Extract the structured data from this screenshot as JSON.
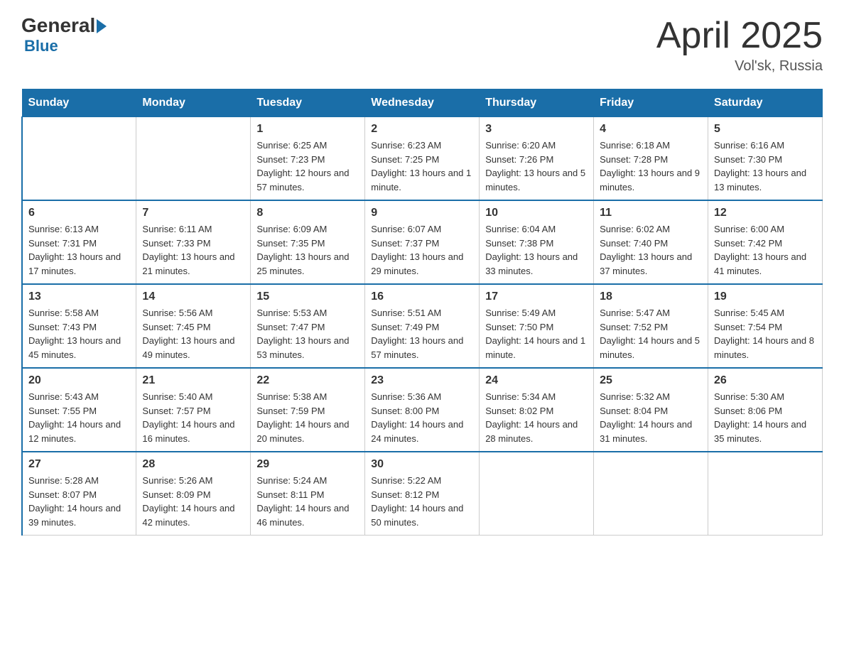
{
  "header": {
    "logo": {
      "general": "General",
      "blue": "Blue"
    },
    "title": "April 2025",
    "location": "Vol'sk, Russia"
  },
  "days_of_week": [
    "Sunday",
    "Monday",
    "Tuesday",
    "Wednesday",
    "Thursday",
    "Friday",
    "Saturday"
  ],
  "weeks": [
    [
      {
        "day": "",
        "sunrise": "",
        "sunset": "",
        "daylight": ""
      },
      {
        "day": "",
        "sunrise": "",
        "sunset": "",
        "daylight": ""
      },
      {
        "day": "1",
        "sunrise": "Sunrise: 6:25 AM",
        "sunset": "Sunset: 7:23 PM",
        "daylight": "Daylight: 12 hours and 57 minutes."
      },
      {
        "day": "2",
        "sunrise": "Sunrise: 6:23 AM",
        "sunset": "Sunset: 7:25 PM",
        "daylight": "Daylight: 13 hours and 1 minute."
      },
      {
        "day": "3",
        "sunrise": "Sunrise: 6:20 AM",
        "sunset": "Sunset: 7:26 PM",
        "daylight": "Daylight: 13 hours and 5 minutes."
      },
      {
        "day": "4",
        "sunrise": "Sunrise: 6:18 AM",
        "sunset": "Sunset: 7:28 PM",
        "daylight": "Daylight: 13 hours and 9 minutes."
      },
      {
        "day": "5",
        "sunrise": "Sunrise: 6:16 AM",
        "sunset": "Sunset: 7:30 PM",
        "daylight": "Daylight: 13 hours and 13 minutes."
      }
    ],
    [
      {
        "day": "6",
        "sunrise": "Sunrise: 6:13 AM",
        "sunset": "Sunset: 7:31 PM",
        "daylight": "Daylight: 13 hours and 17 minutes."
      },
      {
        "day": "7",
        "sunrise": "Sunrise: 6:11 AM",
        "sunset": "Sunset: 7:33 PM",
        "daylight": "Daylight: 13 hours and 21 minutes."
      },
      {
        "day": "8",
        "sunrise": "Sunrise: 6:09 AM",
        "sunset": "Sunset: 7:35 PM",
        "daylight": "Daylight: 13 hours and 25 minutes."
      },
      {
        "day": "9",
        "sunrise": "Sunrise: 6:07 AM",
        "sunset": "Sunset: 7:37 PM",
        "daylight": "Daylight: 13 hours and 29 minutes."
      },
      {
        "day": "10",
        "sunrise": "Sunrise: 6:04 AM",
        "sunset": "Sunset: 7:38 PM",
        "daylight": "Daylight: 13 hours and 33 minutes."
      },
      {
        "day": "11",
        "sunrise": "Sunrise: 6:02 AM",
        "sunset": "Sunset: 7:40 PM",
        "daylight": "Daylight: 13 hours and 37 minutes."
      },
      {
        "day": "12",
        "sunrise": "Sunrise: 6:00 AM",
        "sunset": "Sunset: 7:42 PM",
        "daylight": "Daylight: 13 hours and 41 minutes."
      }
    ],
    [
      {
        "day": "13",
        "sunrise": "Sunrise: 5:58 AM",
        "sunset": "Sunset: 7:43 PM",
        "daylight": "Daylight: 13 hours and 45 minutes."
      },
      {
        "day": "14",
        "sunrise": "Sunrise: 5:56 AM",
        "sunset": "Sunset: 7:45 PM",
        "daylight": "Daylight: 13 hours and 49 minutes."
      },
      {
        "day": "15",
        "sunrise": "Sunrise: 5:53 AM",
        "sunset": "Sunset: 7:47 PM",
        "daylight": "Daylight: 13 hours and 53 minutes."
      },
      {
        "day": "16",
        "sunrise": "Sunrise: 5:51 AM",
        "sunset": "Sunset: 7:49 PM",
        "daylight": "Daylight: 13 hours and 57 minutes."
      },
      {
        "day": "17",
        "sunrise": "Sunrise: 5:49 AM",
        "sunset": "Sunset: 7:50 PM",
        "daylight": "Daylight: 14 hours and 1 minute."
      },
      {
        "day": "18",
        "sunrise": "Sunrise: 5:47 AM",
        "sunset": "Sunset: 7:52 PM",
        "daylight": "Daylight: 14 hours and 5 minutes."
      },
      {
        "day": "19",
        "sunrise": "Sunrise: 5:45 AM",
        "sunset": "Sunset: 7:54 PM",
        "daylight": "Daylight: 14 hours and 8 minutes."
      }
    ],
    [
      {
        "day": "20",
        "sunrise": "Sunrise: 5:43 AM",
        "sunset": "Sunset: 7:55 PM",
        "daylight": "Daylight: 14 hours and 12 minutes."
      },
      {
        "day": "21",
        "sunrise": "Sunrise: 5:40 AM",
        "sunset": "Sunset: 7:57 PM",
        "daylight": "Daylight: 14 hours and 16 minutes."
      },
      {
        "day": "22",
        "sunrise": "Sunrise: 5:38 AM",
        "sunset": "Sunset: 7:59 PM",
        "daylight": "Daylight: 14 hours and 20 minutes."
      },
      {
        "day": "23",
        "sunrise": "Sunrise: 5:36 AM",
        "sunset": "Sunset: 8:00 PM",
        "daylight": "Daylight: 14 hours and 24 minutes."
      },
      {
        "day": "24",
        "sunrise": "Sunrise: 5:34 AM",
        "sunset": "Sunset: 8:02 PM",
        "daylight": "Daylight: 14 hours and 28 minutes."
      },
      {
        "day": "25",
        "sunrise": "Sunrise: 5:32 AM",
        "sunset": "Sunset: 8:04 PM",
        "daylight": "Daylight: 14 hours and 31 minutes."
      },
      {
        "day": "26",
        "sunrise": "Sunrise: 5:30 AM",
        "sunset": "Sunset: 8:06 PM",
        "daylight": "Daylight: 14 hours and 35 minutes."
      }
    ],
    [
      {
        "day": "27",
        "sunrise": "Sunrise: 5:28 AM",
        "sunset": "Sunset: 8:07 PM",
        "daylight": "Daylight: 14 hours and 39 minutes."
      },
      {
        "day": "28",
        "sunrise": "Sunrise: 5:26 AM",
        "sunset": "Sunset: 8:09 PM",
        "daylight": "Daylight: 14 hours and 42 minutes."
      },
      {
        "day": "29",
        "sunrise": "Sunrise: 5:24 AM",
        "sunset": "Sunset: 8:11 PM",
        "daylight": "Daylight: 14 hours and 46 minutes."
      },
      {
        "day": "30",
        "sunrise": "Sunrise: 5:22 AM",
        "sunset": "Sunset: 8:12 PM",
        "daylight": "Daylight: 14 hours and 50 minutes."
      },
      {
        "day": "",
        "sunrise": "",
        "sunset": "",
        "daylight": ""
      },
      {
        "day": "",
        "sunrise": "",
        "sunset": "",
        "daylight": ""
      },
      {
        "day": "",
        "sunrise": "",
        "sunset": "",
        "daylight": ""
      }
    ]
  ]
}
